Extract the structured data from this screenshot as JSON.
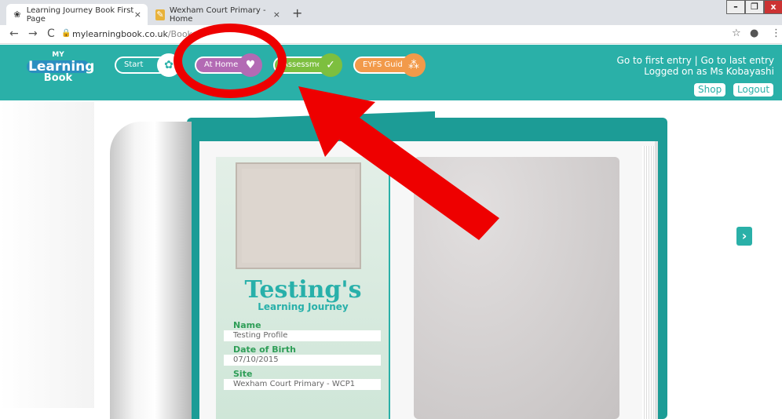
{
  "browser": {
    "tabs": [
      {
        "title": "Learning Journey Book First Page",
        "close": "×"
      },
      {
        "title": "Wexham Court Primary - Home",
        "close": "×"
      }
    ],
    "new_tab": "+",
    "url_main": "mylearningbook.co.uk",
    "url_path": "/Book",
    "nav": {
      "back": "←",
      "forward": "→",
      "reload": "C"
    },
    "window": {
      "min": "–",
      "restore": "❐",
      "close": "x"
    }
  },
  "header": {
    "logo": {
      "line1": "MY",
      "line2": "Learning",
      "line3": "Book"
    },
    "nav_buttons": [
      {
        "label": "Start",
        "color": "#2ab0a8"
      },
      {
        "label": "At Home",
        "color": "#b36ab4"
      },
      {
        "label": "Assessments",
        "color": "#7dbf3f"
      },
      {
        "label": "EYFS Guide",
        "color": "#f29a4a"
      }
    ],
    "links_line1": "Go to first entry  |  Go to last entry",
    "links_line2": "Logged on as Ms Kobayashi",
    "shop": "Shop",
    "logout": "Logout"
  },
  "book": {
    "title": "Testing's",
    "subtitle": "Learning Journey",
    "fields": [
      {
        "label": "Name",
        "value": "Testing Profile"
      },
      {
        "label": "Date of Birth",
        "value": "07/10/2015"
      },
      {
        "label": "Site",
        "value": "Wexham Court Primary - WCP1"
      }
    ],
    "next_icon": "›"
  }
}
